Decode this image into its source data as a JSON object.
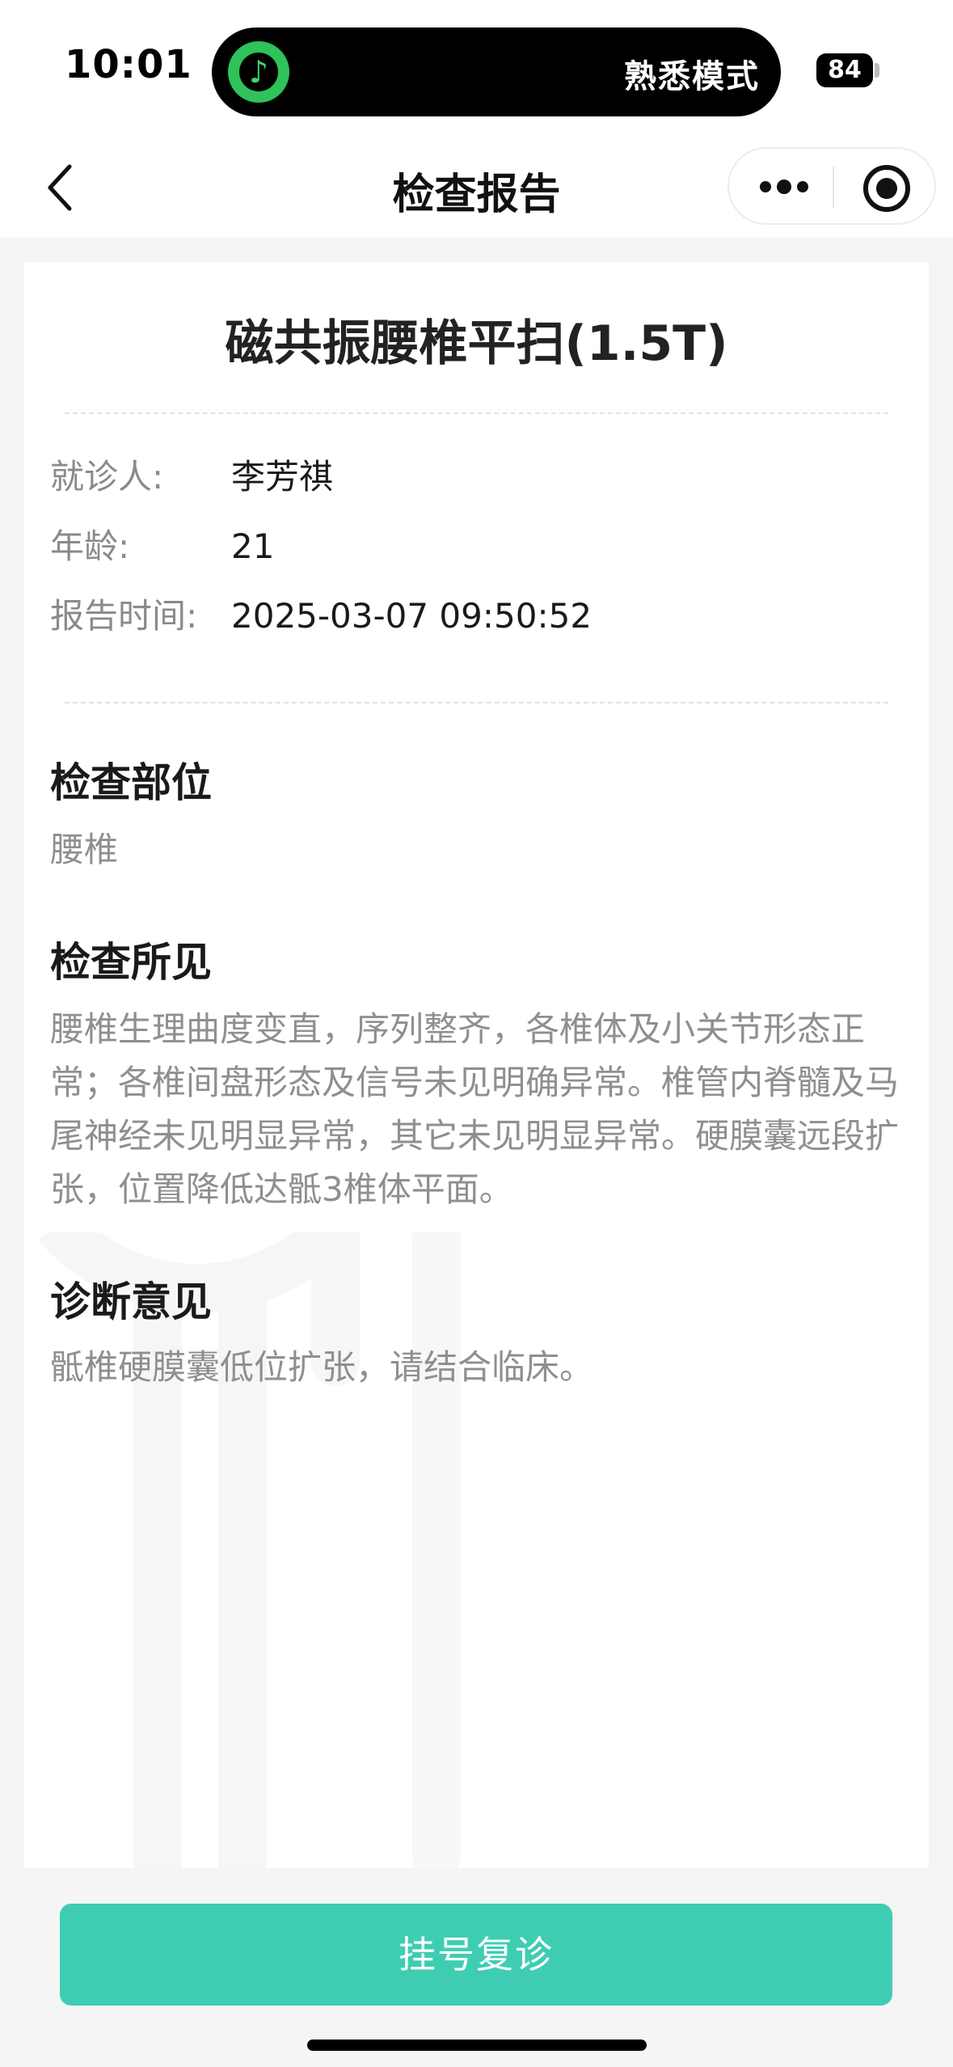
{
  "status_bar": {
    "time": "10:01",
    "island_text": "熟悉模式",
    "battery": "84"
  },
  "nav": {
    "title": "检查报告"
  },
  "report": {
    "title": "磁共振腰椎平扫(1.5T)",
    "info": [
      {
        "label": "就诊人:",
        "value": "李芳祺"
      },
      {
        "label": "年龄:",
        "value": "21"
      },
      {
        "label": "报告时间:",
        "value": "2025-03-07 09:50:52"
      }
    ],
    "sections": [
      {
        "heading": "检查部位",
        "text": "腰椎"
      },
      {
        "heading": "检查所见",
        "text": "腰椎生理曲度变直，序列整齐，各椎体及小关节形态正常；各椎间盘形态及信号未见明确异常。椎管内脊髓及马尾神经未见明显异常，其它未见明显异常。硬膜囊远段扩张，位置降低达骶3椎体平面。"
      },
      {
        "heading": "诊断意见",
        "text": "骶椎硬膜囊低位扩张，请结合临床。"
      }
    ]
  },
  "footer": {
    "register_label": "挂号复诊"
  },
  "colors": {
    "accent": "#3ecdb3",
    "page_bg": "#f5f5f5",
    "label_gray": "#8a8a8a"
  }
}
